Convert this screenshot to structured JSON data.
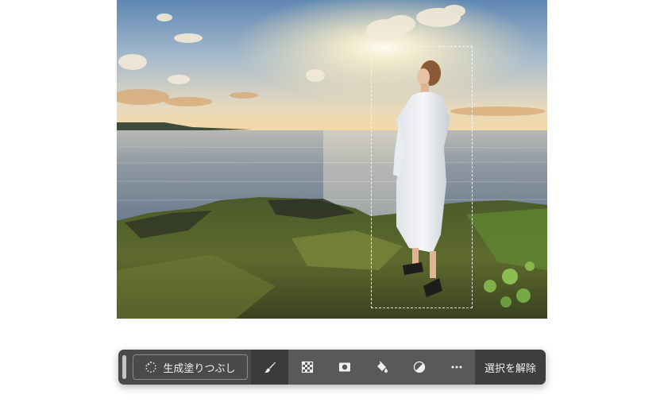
{
  "taskbar": {
    "generative_fill_label": "生成塗りつぶし",
    "deselect_label": "選択を解除",
    "tools": [
      {
        "icon": "brush-icon",
        "active": true
      },
      {
        "icon": "transparency-grid-icon",
        "active": false
      },
      {
        "icon": "mask-icon",
        "active": false
      },
      {
        "icon": "paint-bucket-icon",
        "active": false
      },
      {
        "icon": "adjustment-circle-icon",
        "active": false
      },
      {
        "icon": "more-icon",
        "active": false
      }
    ]
  },
  "colors": {
    "taskbar_bg": "#4a4a4a",
    "taskbar_text": "#f0f0f0"
  }
}
